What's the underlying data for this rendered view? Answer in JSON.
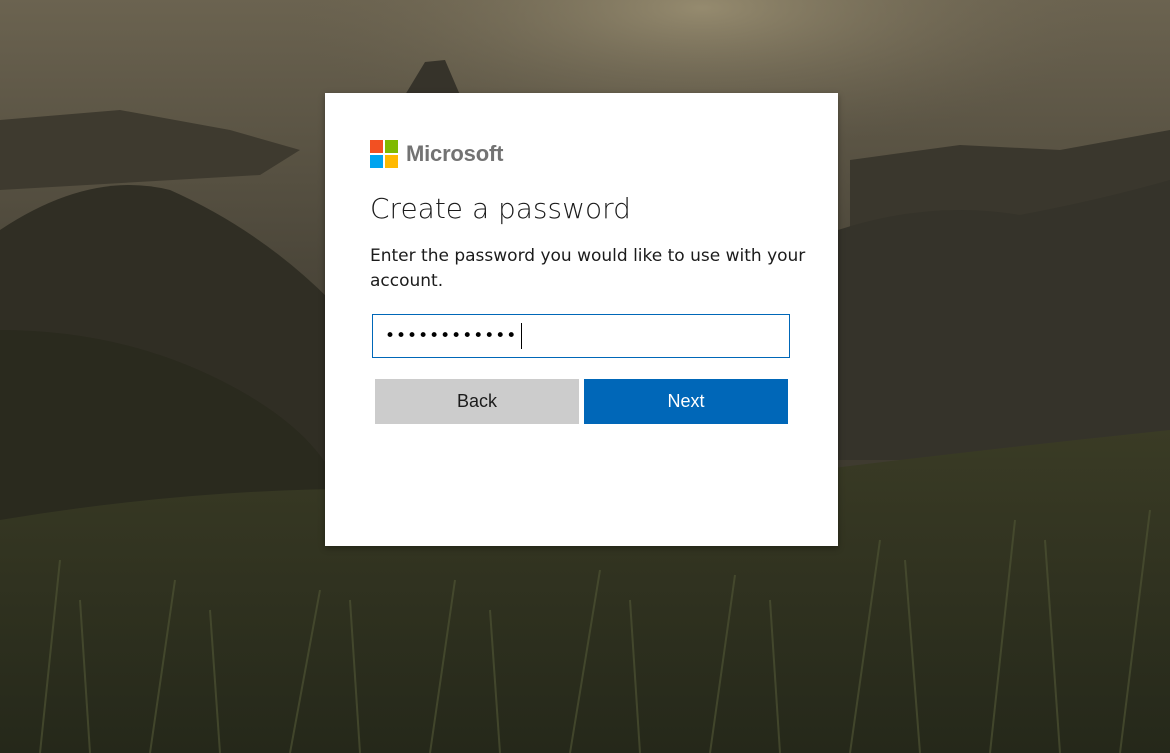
{
  "brand": {
    "name": "Microsoft",
    "logo_colors": [
      "#f25022",
      "#7fba00",
      "#00a4ef",
      "#ffb900"
    ]
  },
  "dialog": {
    "title": "Create a password",
    "description": "Enter the password you would like to use with your account.",
    "password_value": "••••••••••••",
    "buttons": {
      "back_label": "Back",
      "next_label": "Next"
    }
  },
  "colors": {
    "primary": "#0067b8",
    "secondary_button": "#cccccc",
    "background": "#2b2a22"
  }
}
